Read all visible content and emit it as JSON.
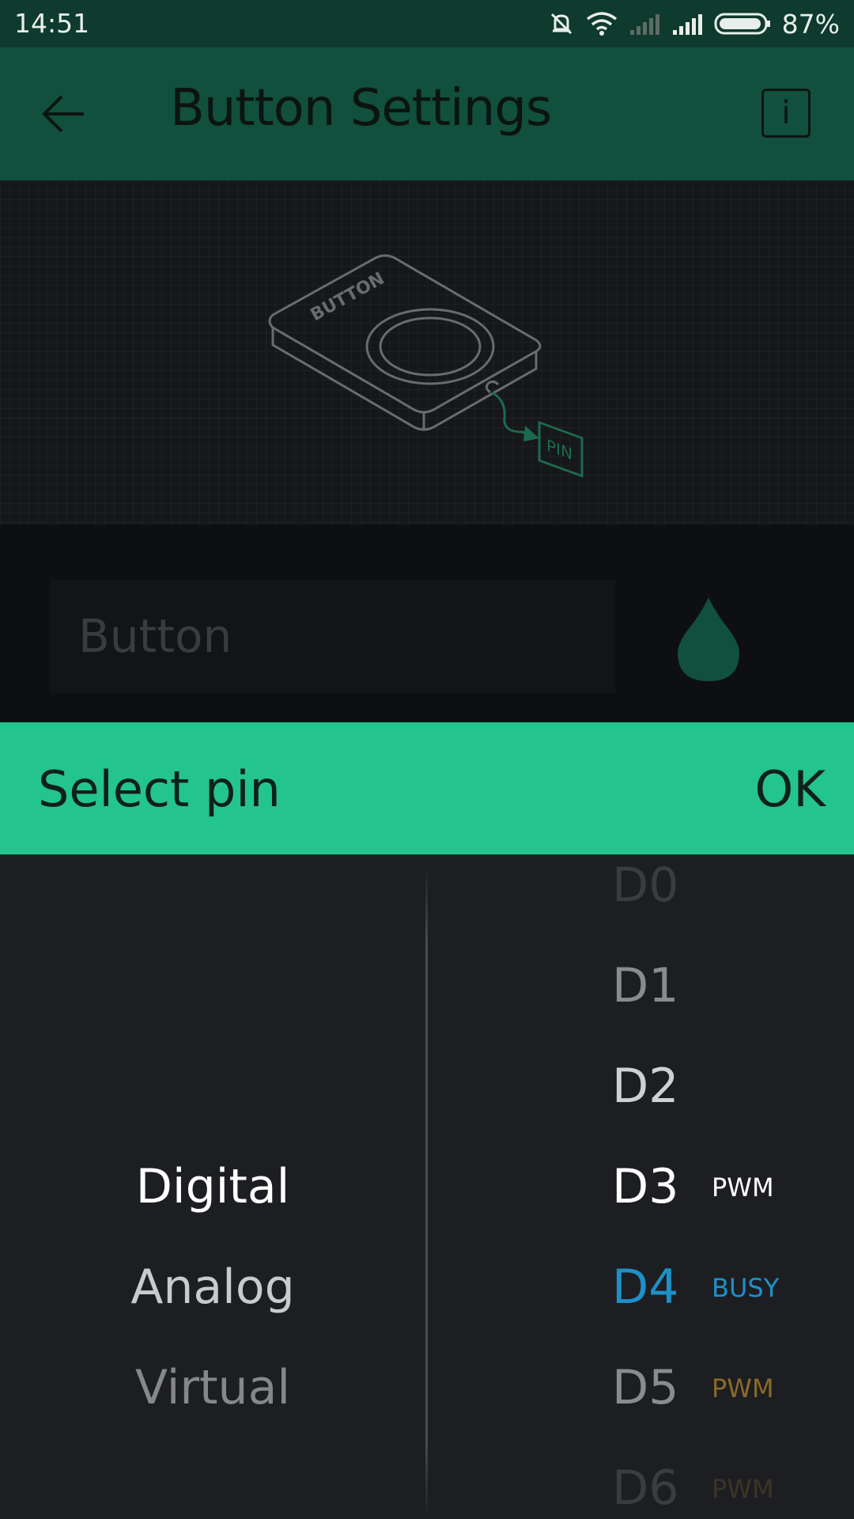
{
  "status_bar": {
    "time": "14:51",
    "battery": "87%"
  },
  "app_bar": {
    "title": "Button Settings",
    "info_label": "i"
  },
  "preview": {
    "device_label": "BUTTON",
    "pin_label": "PIN"
  },
  "widget": {
    "name_placeholder": "Button",
    "color": "#11503c"
  },
  "pin_dialog": {
    "title": "Select pin",
    "ok_label": "OK",
    "modes": [
      {
        "label": "Digital",
        "color": "#ffffff"
      },
      {
        "label": "Analog",
        "color": "#c9cacd"
      },
      {
        "label": "Virtual",
        "color": "#85878b"
      }
    ],
    "pins": [
      {
        "label": "D0",
        "tag": "",
        "color": "#3b3c40",
        "tag_color": ""
      },
      {
        "label": "D1",
        "tag": "",
        "color": "#8a8b8f",
        "tag_color": ""
      },
      {
        "label": "D2",
        "tag": "",
        "color": "#cfd0d3",
        "tag_color": ""
      },
      {
        "label": "D3",
        "tag": "PWM",
        "color": "#ffffff",
        "tag_color": "#ffffff"
      },
      {
        "label": "D4",
        "tag": "BUSY",
        "color": "#1e90c8",
        "tag_color": "#1e90c8"
      },
      {
        "label": "D5",
        "tag": "PWM",
        "color": "#8a8b8f",
        "tag_color": "#8a6a2a"
      },
      {
        "label": "D6",
        "tag": "PWM",
        "color": "#3b3c40",
        "tag_color": "#3d3424"
      }
    ]
  }
}
